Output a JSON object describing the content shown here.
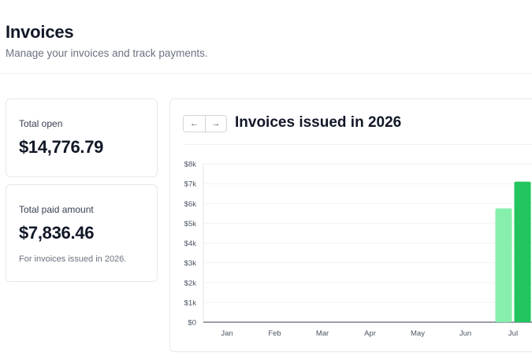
{
  "header": {
    "title": "Invoices",
    "subtitle": "Manage your invoices and track payments."
  },
  "stats": {
    "open": {
      "label": "Total open",
      "value": "$14,776.79"
    },
    "paid": {
      "label": "Total paid amount",
      "value": "$7,836.46",
      "note": "For invoices issued in 2026."
    }
  },
  "chart_panel": {
    "title": "Invoices issued in 2026",
    "prev_icon": "arrow-left-icon",
    "next_icon": "arrow-right-icon",
    "prev_glyph": "←",
    "next_glyph": "→"
  },
  "chart_data": {
    "type": "bar",
    "title": "Invoices issued in 2026",
    "categories": [
      "Jan",
      "Feb",
      "Mar",
      "Apr",
      "May",
      "Jun",
      "Jul"
    ],
    "series": [
      {
        "values": [
          0,
          0,
          0,
          0,
          0,
          0,
          5750
        ],
        "color": "#86efac"
      },
      {
        "values": [
          0,
          0,
          0,
          0,
          0,
          0,
          7100
        ],
        "color": "#22c55e"
      }
    ],
    "ylim": [
      0,
      8000
    ],
    "yticks": [
      "$0",
      "$1k",
      "$2k",
      "$3k",
      "$4k",
      "$5k",
      "$6k",
      "$7k",
      "$8k"
    ],
    "grid": true,
    "xlabel": "",
    "ylabel": ""
  }
}
